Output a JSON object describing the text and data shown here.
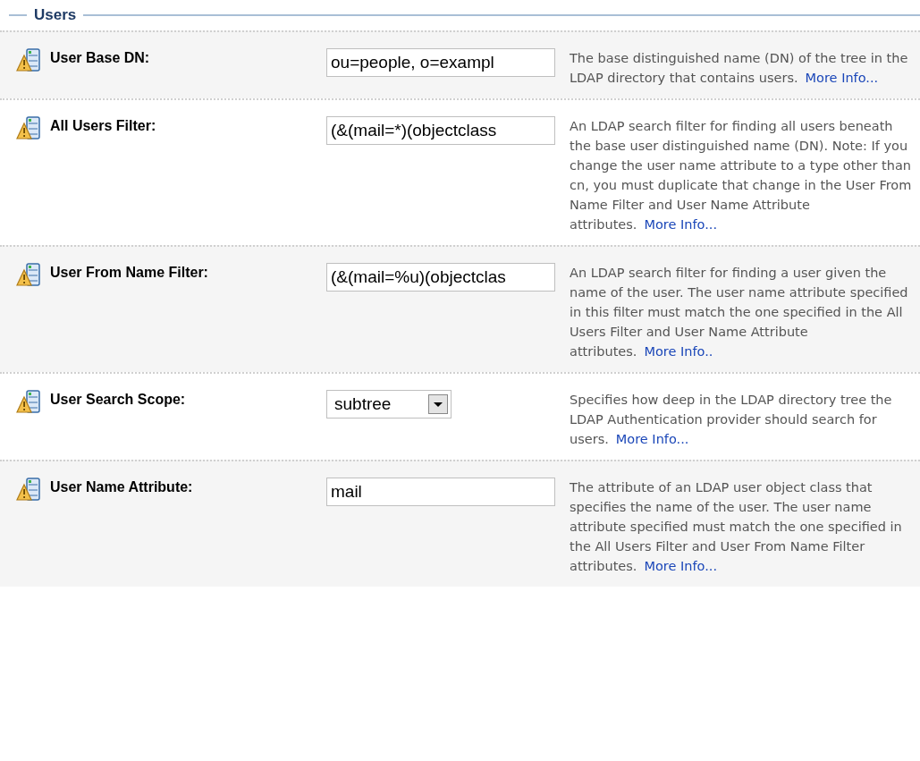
{
  "section": {
    "title": "Users"
  },
  "fields": [
    {
      "kind": "text",
      "label": "User Base DN:",
      "value": "ou=people, o=exampl",
      "description": "The base distinguished name (DN) of the tree in the LDAP directory that contains users.",
      "link": "More Info..."
    },
    {
      "kind": "text",
      "label": "All Users Filter:",
      "value": "(&(mail=*)(objectclass",
      "description": "An LDAP search filter for finding all users beneath the base user distinguished name (DN). Note: If you change the user name attribute to a type other than cn, you must duplicate that change in the User From Name Filter and User Name Attribute attributes.",
      "link": "More Info..."
    },
    {
      "kind": "text",
      "label": "User From Name Filter:",
      "value": "(&(mail=%u)(objectclas",
      "description": "An LDAP search filter for finding a user given the name of the user. The user name attribute specified in this filter must match the one specified in the All Users Filter and User Name Attribute attributes.",
      "link": "More Info.."
    },
    {
      "kind": "select",
      "label": "User Search Scope:",
      "value": "subtree",
      "description": "Specifies how deep in the LDAP directory tree the LDAP Authentication provider should search for users.",
      "link": "More Info..."
    },
    {
      "kind": "text",
      "label": "User Name Attribute:",
      "value": "mail",
      "description": "The attribute of an LDAP user object class that specifies the name of the user. The user name attribute specified must match the one specified in the All Users Filter and User From Name Filter attributes.",
      "link": "More Info..."
    }
  ]
}
